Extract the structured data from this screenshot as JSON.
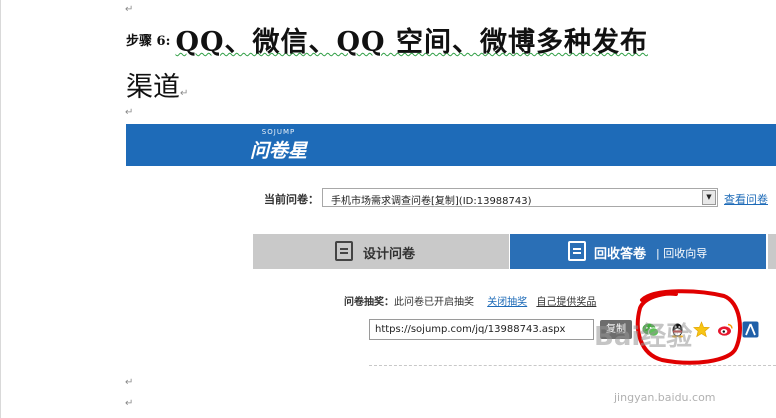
{
  "doc": {
    "step_label": "步骤 6:",
    "heading_line1": "QQ、微信、QQ 空间、微博多种发布",
    "heading_line2": "渠道",
    "paragraph_mark": "↵"
  },
  "site": {
    "logo_sub": "SOJUMP",
    "logo_name": "问卷星",
    "brand_color": "#1e6bb8"
  },
  "survey_select": {
    "label": "当前问卷：",
    "value": "手机市场需求调查问卷[复制](ID:13988743)",
    "view_link": "查看问卷"
  },
  "tabs": [
    {
      "label": "设计问卷",
      "icon": "edit-icon",
      "active": false
    },
    {
      "label": "回收答卷",
      "sub_label": "| 回收向导",
      "icon": "clipboard-icon",
      "active": true
    }
  ],
  "lottery": {
    "label": "问卷抽奖：",
    "status": "此问卷已开启抽奖",
    "close_link": "关闭抽奖",
    "own_prize_link": "自己提供奖品"
  },
  "share": {
    "url": "https://sojump.com/jq/13988743.aspx",
    "copy_label": "复制",
    "icons": [
      "wechat-icon",
      "qq-icon",
      "qzone-icon",
      "weibo-icon",
      "renren-icon"
    ]
  },
  "watermark": {
    "text": "Bai经验",
    "url": "jingyan.baidu.com"
  }
}
